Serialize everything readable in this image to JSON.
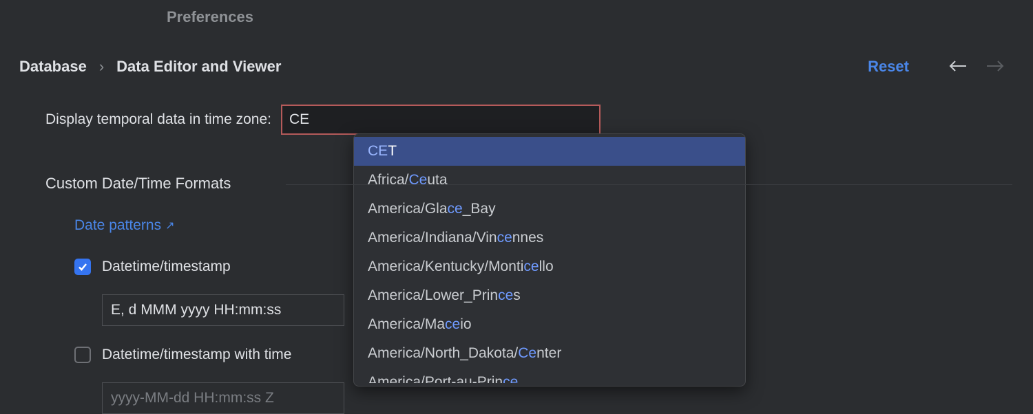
{
  "header": {
    "title": "Preferences"
  },
  "breadcrumb": {
    "root": "Database",
    "leaf": "Data Editor and Viewer"
  },
  "actions": {
    "reset": "Reset"
  },
  "timezone": {
    "label": "Display temporal data in time zone:",
    "value": "CE",
    "suggestions": [
      {
        "pre": "",
        "hl": "CE",
        "post": "T",
        "selected": true
      },
      {
        "pre": "Africa/",
        "hl": "Ce",
        "post": "uta"
      },
      {
        "pre": "America/Gla",
        "hl": "ce",
        "post": "_Bay"
      },
      {
        "pre": "America/Indiana/Vin",
        "hl": "ce",
        "post": "nnes"
      },
      {
        "pre": "America/Kentucky/Monti",
        "hl": "ce",
        "post": "llo"
      },
      {
        "pre": "America/Lower_Prin",
        "hl": "ce",
        "post": "s"
      },
      {
        "pre": "America/Ma",
        "hl": "ce",
        "post": "io"
      },
      {
        "pre": "America/North_Dakota/",
        "hl": "Ce",
        "post": "nter"
      },
      {
        "pre": "America/Port-au-Prin",
        "hl": "ce",
        "post": ""
      }
    ]
  },
  "formats": {
    "section_title": "Custom Date/Time Formats",
    "link": "Date patterns",
    "datetime": {
      "label": "Datetime/timestamp",
      "checked": true,
      "value": "E, d MMM yyyy HH:mm:ss"
    },
    "datetime_tz": {
      "label": "Datetime/timestamp with time",
      "checked": false,
      "value": "yyyy-MM-dd HH:mm:ss Z"
    }
  }
}
